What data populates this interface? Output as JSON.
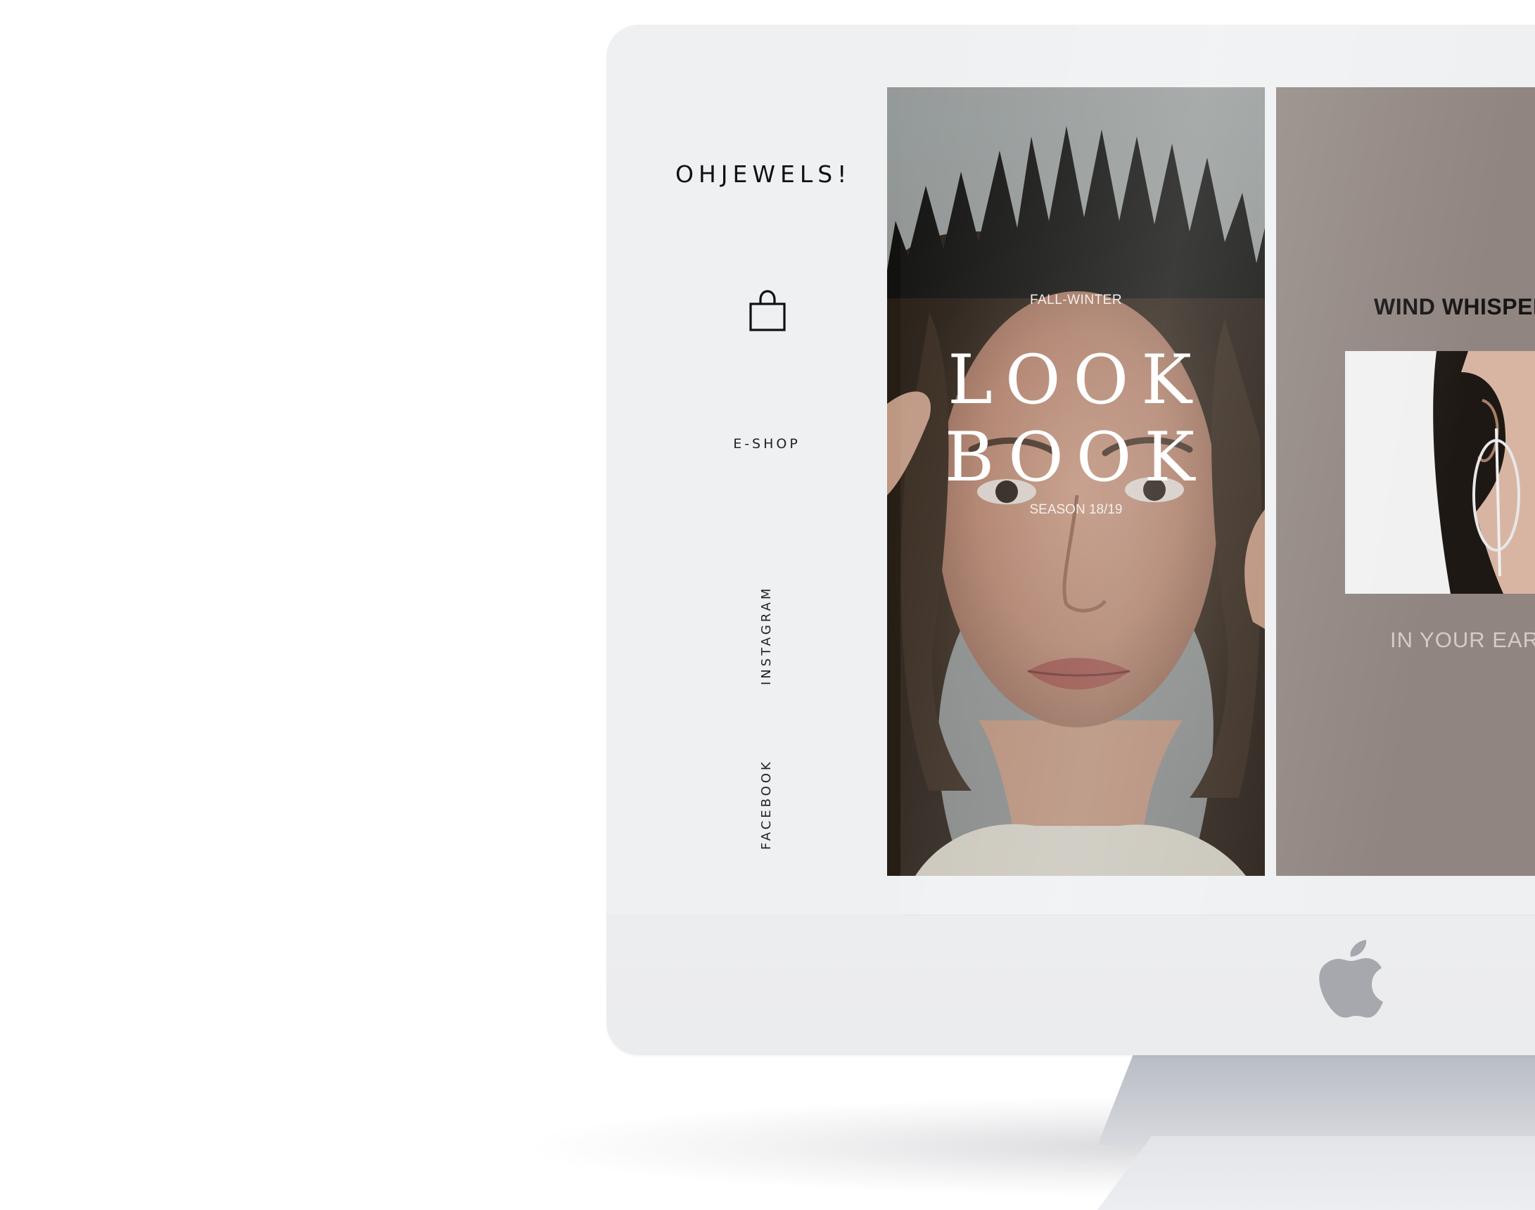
{
  "brand": {
    "logo_text": "OHJEWELS!"
  },
  "sidebar": {
    "shop_icon": "shopping-bag-icon",
    "eshop_label": "E-SHOP",
    "instagram_label": "INSTAGRAM",
    "facebook_label": "FACEBOOK"
  },
  "lookbook": {
    "kicker": "FALL-WINTER",
    "title_line1": "LOOK",
    "title_line2": "BOOK",
    "season": "SEASON 18/19"
  },
  "feature": {
    "title": "WIND WHISPER",
    "subtitle": "IN YOUR EAR"
  },
  "device": {
    "logo_icon": "apple-logo-icon"
  },
  "colors": {
    "monitor": "#eeeff1",
    "feature_panel": "#908580",
    "text_dark": "#111111",
    "text_light": "#ffffff"
  }
}
